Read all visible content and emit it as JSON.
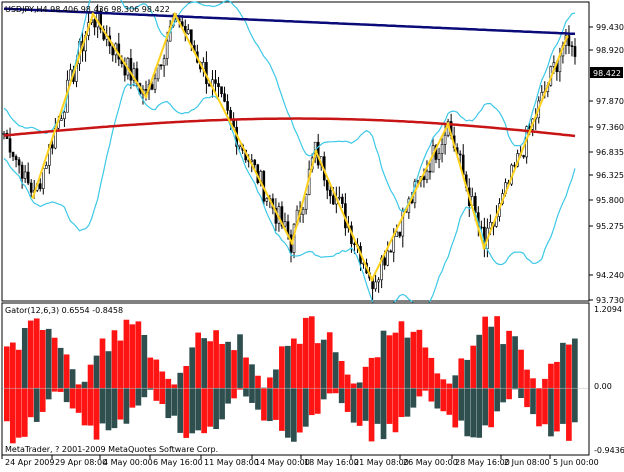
{
  "main_chart": {
    "header": "USDJPY,H4  98.406 98.436 98.306 98.422",
    "current_price": "98.422",
    "y_ticks": [
      "99.430",
      "98.920",
      "97.870",
      "97.360",
      "96.835",
      "96.325",
      "95.800",
      "95.275",
      "94.240",
      "93.730"
    ],
    "colors": {
      "candles": "#000000",
      "bollinger": "#3cc8e6",
      "zigzag": "#ffd21e",
      "ma_fast": "#c81414",
      "ma_slow": "#0a0a78",
      "price_box": "#000000"
    }
  },
  "sub_chart": {
    "header": "Gator(12,6,3) 0.6554 -0.8458",
    "y_ticks": [
      "1.2094",
      "0.00",
      "-0.9436"
    ],
    "colors": {
      "up": "#ff1414",
      "down": "#2f4f4f"
    }
  },
  "copyright": "MetaTrader, ? 2001-2009 MetaQuotes Software Corp.",
  "x_ticks": [
    "24 Apr 2009",
    "29 Apr 08:00",
    "4 May 00:00",
    "6 May 16:00",
    "11 May 08:00",
    "14 May 00:00",
    "18 May 16:00",
    "21 May 08:00",
    "26 May 00:00",
    "28 May 16:00",
    "2 Jun 08:00",
    "5 Jun 00:00"
  ],
  "chart_data": {
    "type": "candlestick",
    "symbol": "USDJPY",
    "timeframe": "H4",
    "ylim": [
      93.4,
      99.8
    ],
    "zigzag_points": [
      {
        "x": "24 Apr 2009",
        "y": 95.6
      },
      {
        "x": "4 May 00:00",
        "y": 99.6
      },
      {
        "x": "6 May 00:00",
        "y": 97.8
      },
      {
        "x": "6 May 16:00",
        "y": 99.6
      },
      {
        "x": "14 May 00:00",
        "y": 94.6
      },
      {
        "x": "18 May 16:00",
        "y": 96.6
      },
      {
        "x": "21 May 08:00",
        "y": 93.8
      },
      {
        "x": "28 May 00:00",
        "y": 97.2
      },
      {
        "x": "2 Jun 00:00",
        "y": 94.5
      },
      {
        "x": "5 Jun 16:00",
        "y": 99.1
      }
    ],
    "gator_ylim": [
      -0.9436,
      1.2094
    ]
  }
}
